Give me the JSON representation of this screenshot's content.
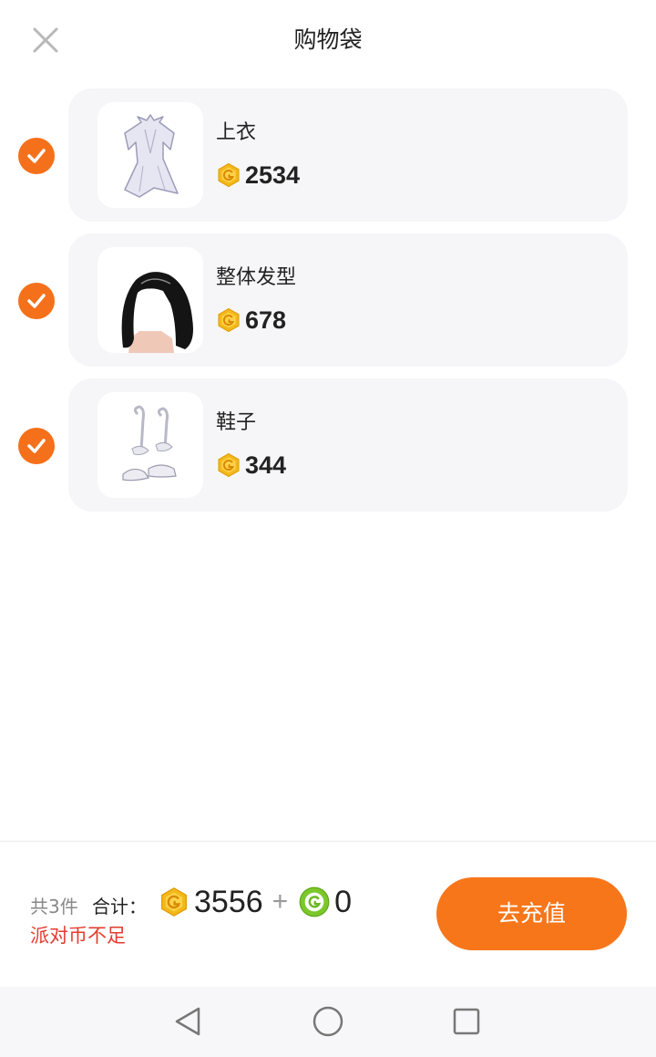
{
  "header": {
    "title": "购物袋"
  },
  "items": [
    {
      "name": "上衣",
      "price": "2534",
      "checked": true,
      "image": "white-dress-icon"
    },
    {
      "name": "整体发型",
      "price": "678",
      "checked": true,
      "image": "black-hair-icon"
    },
    {
      "name": "鞋子",
      "price": "344",
      "checked": true,
      "image": "white-shoes-icon"
    }
  ],
  "footer": {
    "count_text": "共3件",
    "total_label": "合计：",
    "total_gold": "3556",
    "plus": "+",
    "total_green": "0",
    "warning": "派对币不足",
    "recharge_label": "去充值"
  },
  "colors": {
    "accent": "#f7761a",
    "warning": "#e43c2f",
    "gold_coin": "#f3b81a",
    "green_coin": "#7cc82a"
  }
}
